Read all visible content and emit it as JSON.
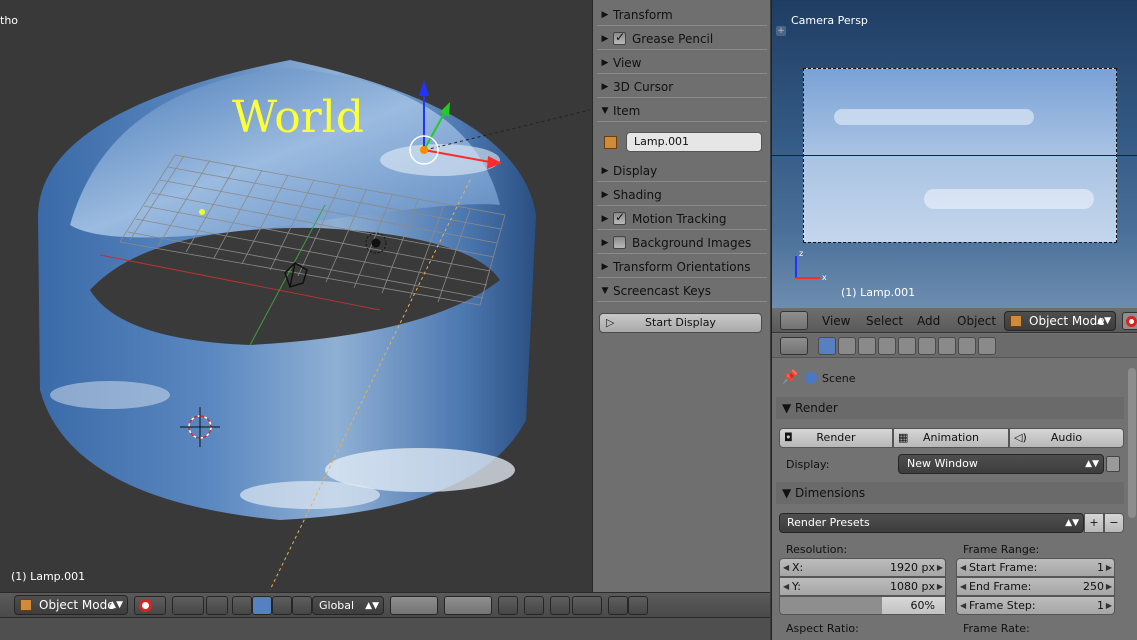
{
  "viewport": {
    "view_label": "tho",
    "world_text": "World",
    "object_label": "(1) Lamp.001"
  },
  "npanel": {
    "sections": [
      {
        "label": "Transform",
        "expanded": false,
        "checkbox": null
      },
      {
        "label": "Grease Pencil",
        "expanded": false,
        "checkbox": true
      },
      {
        "label": "View",
        "expanded": false,
        "checkbox": null
      },
      {
        "label": "3D Cursor",
        "expanded": false,
        "checkbox": null
      },
      {
        "label": "Item",
        "expanded": true,
        "checkbox": null
      },
      {
        "label": "Display",
        "expanded": false,
        "checkbox": null
      },
      {
        "label": "Shading",
        "expanded": false,
        "checkbox": null
      },
      {
        "label": "Motion Tracking",
        "expanded": false,
        "checkbox": true
      },
      {
        "label": "Background Images",
        "expanded": false,
        "checkbox": false
      },
      {
        "label": "Transform Orientations",
        "expanded": false,
        "checkbox": null
      },
      {
        "label": "Screencast Keys",
        "expanded": true,
        "checkbox": null
      }
    ],
    "item_name": "Lamp.001",
    "start_display_label": "Start Display"
  },
  "camera_view": {
    "title": "Camera Persp",
    "object_label": "(1) Lamp.001"
  },
  "props_header": {
    "menus": [
      "View",
      "Select",
      "Add",
      "Object"
    ],
    "mode": "Object Mode"
  },
  "properties": {
    "context": "Scene",
    "render_panel": {
      "title": "Render",
      "buttons": [
        "Render",
        "Animation",
        "Audio"
      ],
      "display_label": "Display:",
      "display_value": "New Window"
    },
    "dimensions_panel": {
      "title": "Dimensions",
      "presets": "Render Presets",
      "resolution_label": "Resolution:",
      "res_x_label": "X:",
      "res_x": "1920 px",
      "res_y_label": "Y:",
      "res_y": "1080 px",
      "res_pct": "60%",
      "frame_range_label": "Frame Range:",
      "start_frame_label": "Start Frame:",
      "start_frame": "1",
      "end_frame_label": "End Frame:",
      "end_frame": "250",
      "frame_step_label": "Frame Step:",
      "frame_step": "1",
      "aspect_label": "Aspect Ratio:",
      "frame_rate_label": "Frame Rate:"
    }
  },
  "bottom_header": {
    "mode": "Object Mode",
    "orientation": "Global"
  },
  "colors": {
    "selected_blue": "#5680c2",
    "world_text": "#ffff33",
    "panel_bg": "#727272"
  }
}
